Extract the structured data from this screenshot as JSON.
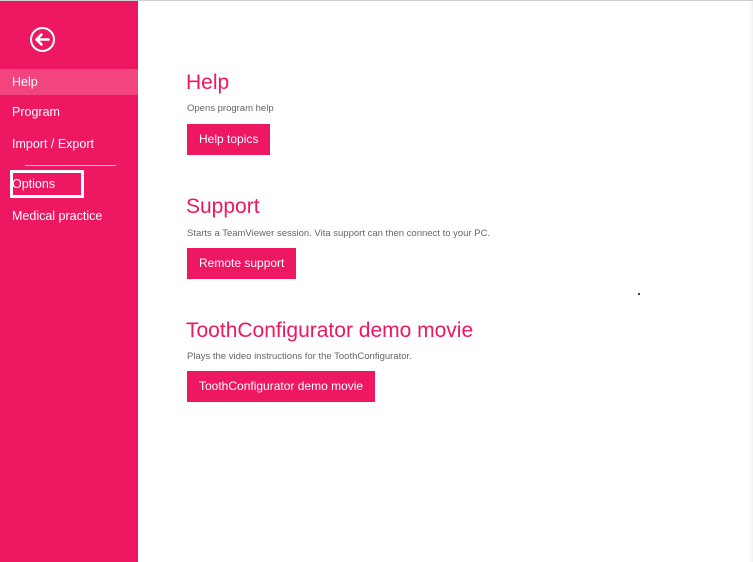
{
  "sidebar": {
    "back_icon": "arrow-left-circle-icon",
    "items": [
      {
        "label": "Help"
      },
      {
        "label": "Program"
      },
      {
        "label": "Import / Export"
      },
      {
        "label": "Options"
      },
      {
        "label": "Medical practice"
      }
    ]
  },
  "sections": [
    {
      "title": "Help",
      "description": "Opens program help",
      "button": "Help topics"
    },
    {
      "title": "Support",
      "description": "Starts a TeamViewer session. Vita support can then connect to your PC.",
      "button": "Remote support"
    },
    {
      "title": "ToothConfigurator demo movie",
      "description": "Plays the video instructions for the ToothConfigurator.",
      "button": "ToothConfigurator demo movie"
    }
  ],
  "colors": {
    "accent": "#ee1762",
    "sidebar_active": "#f2457f"
  }
}
